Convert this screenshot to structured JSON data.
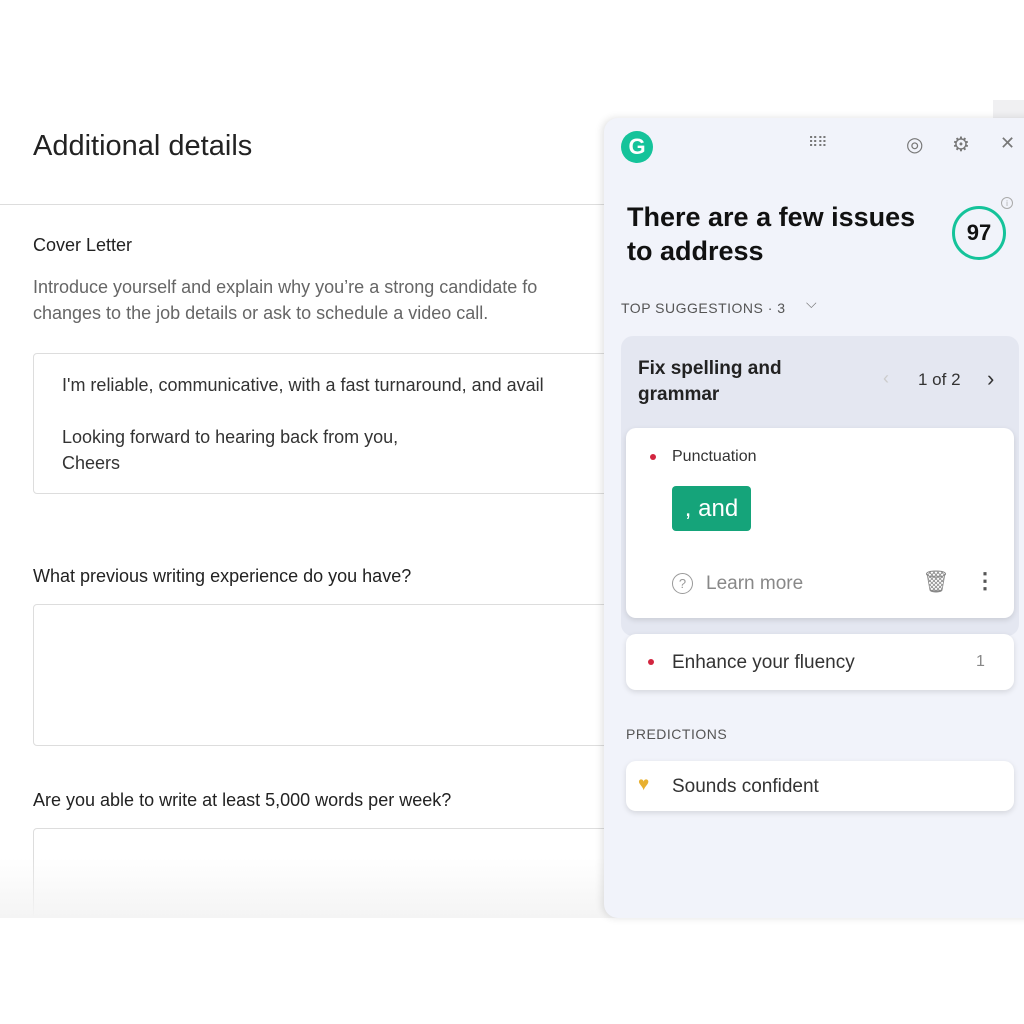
{
  "page": {
    "title": "Additional details",
    "cover_label": "Cover Letter",
    "cover_desc": [
      "Introduce yourself and explain why you’re a strong candidate fo",
      "changes to the job details or ask to schedule a video call."
    ],
    "cover_text": "I'm reliable, communicative, with a fast turnaround, and avail\n\nLooking forward to hearing back from you,\nCheers",
    "q1": "What previous writing experience do you have?",
    "q1_value": "",
    "q2": "Are you able to write at least 5,000 words per week?",
    "q2_value": ""
  },
  "panel": {
    "logo": "G",
    "heading": "There are a few issues to address",
    "score": "97",
    "score_color": "#15c39a",
    "top_suggestions": "TOP SUGGESTIONS · 3",
    "group_title": "Fix spelling and grammar",
    "pager": "1 of 2",
    "card": {
      "category": "Punctuation",
      "suggestion": ", and",
      "learn_more": "Learn more"
    },
    "fluency": {
      "label": "Enhance your fluency",
      "count": "1"
    },
    "predictions": "PREDICTIONS",
    "prediction": "Sounds confident",
    "accent": "#15c39a",
    "error_dot": "#d2253f"
  }
}
